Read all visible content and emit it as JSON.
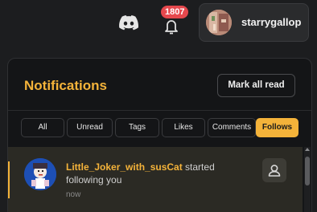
{
  "header": {
    "notification_count": "1807",
    "username": "starrygallop"
  },
  "panel": {
    "title": "Notifications",
    "mark_all_read_label": "Mark all read",
    "tabs": [
      {
        "label": "All",
        "active": false
      },
      {
        "label": "Unread",
        "active": false
      },
      {
        "label": "Tags",
        "active": false
      },
      {
        "label": "Likes",
        "active": false
      },
      {
        "label": "Comments",
        "active": false
      },
      {
        "label": "Follows",
        "active": true
      }
    ],
    "notifications": [
      {
        "user": "Little_Joker_with_susCat",
        "action_start": " started",
        "action_end": "following you",
        "time": "now",
        "unread": true
      }
    ]
  },
  "icons": {
    "discord": "discord-icon",
    "bell": "bell-icon",
    "profile": "user-profile-icon"
  },
  "colors": {
    "accent": "#f4b33a",
    "badge": "#e5484d",
    "background": "#1c1d1f",
    "panel": "#141517",
    "unread_row": "#2b2a24"
  }
}
